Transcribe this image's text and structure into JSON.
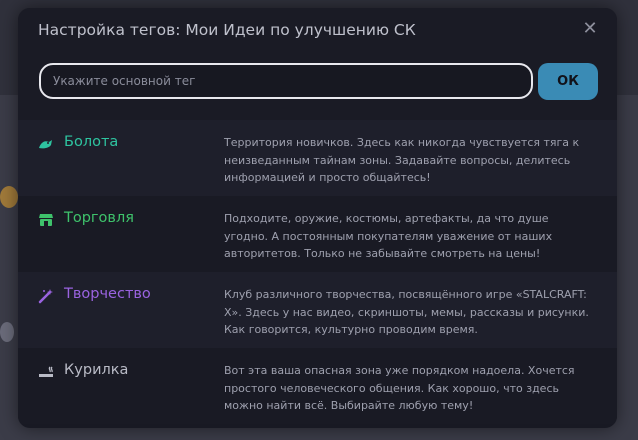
{
  "dialog": {
    "title": "Настройка тегов: Мои Идеи по улучшению СК",
    "close_glyph": "✕",
    "input_placeholder": "Укажите основной тег",
    "ok_label": "ОК"
  },
  "tags": [
    {
      "name": "Болота",
      "icon": "swamp-icon",
      "color": "#2ec4a0",
      "description": "Территория новичков. Здесь как никогда чувствуется тяга к неизведанным тайнам зоны. Задавайте вопросы, делитесь информацией и просто общайтесь!"
    },
    {
      "name": "Торговля",
      "icon": "shop-icon",
      "color": "#3ec26b",
      "description": "Подходите, оружие, костюмы, артефакты, да что душе угодно. А постоянным покупателям уважение от наших авторитетов. Только не забывайте смотреть на цены!"
    },
    {
      "name": "Творчество",
      "icon": "magic-wand-icon",
      "color": "#9a63e0",
      "description": "Клуб различного творчества, посвящённого игре «STALCRAFT: X». Здесь у нас видео, скриншоты, мемы, рассказы и рисунки. Как говорится, культурно проводим время."
    },
    {
      "name": "Курилка",
      "icon": "cigarette-icon",
      "color": "#b9bbc6",
      "description": "Вот эта ваша опасная зона уже порядком надоела. Хочется простого человеческого общения. Как хорошо, что здесь можно найти всё. Выбирайте любую тему!"
    }
  ]
}
